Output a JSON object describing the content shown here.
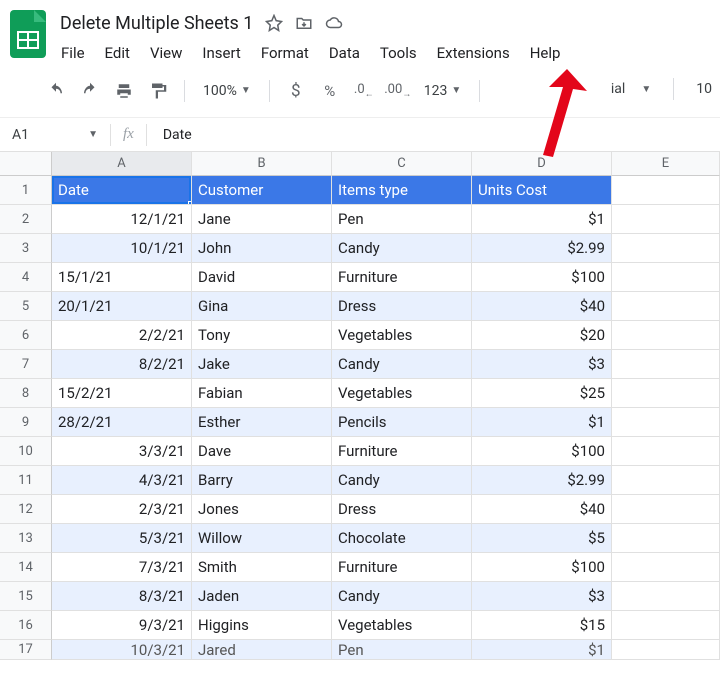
{
  "doc_title": "Delete Multiple Sheets 1",
  "menus": [
    "File",
    "Edit",
    "View",
    "Insert",
    "Format",
    "Data",
    "Tools",
    "Extensions",
    "Help"
  ],
  "toolbar": {
    "zoom": "100%",
    "num_tail": "123",
    "font_right_label": "ial",
    "font_right_num": "10"
  },
  "name_box": "A1",
  "fx_value": "Date",
  "columns": [
    "A",
    "B",
    "C",
    "D",
    "E"
  ],
  "headers": [
    "Date",
    "Customer",
    "Items type",
    "Units Cost"
  ],
  "rows": [
    [
      "12/1/21",
      "Jane",
      "Pen",
      "$1"
    ],
    [
      "10/1/21",
      "John",
      "Candy",
      "$2.99"
    ],
    [
      "15/1/21",
      "David",
      "Furniture",
      "$100"
    ],
    [
      "20/1/21",
      "Gina",
      "Dress",
      "$40"
    ],
    [
      "2/2/21",
      "Tony",
      "Vegetables",
      "$20"
    ],
    [
      "8/2/21",
      "Jake",
      "Candy",
      "$3"
    ],
    [
      "15/2/21",
      "Fabian",
      "Vegetables",
      "$25"
    ],
    [
      "28/2/21",
      "Esther",
      "Pencils",
      "$1"
    ],
    [
      "3/3/21",
      "Dave",
      "Furniture",
      "$100"
    ],
    [
      "4/3/21",
      "Barry",
      "Candy",
      "$2.99"
    ],
    [
      "2/3/21",
      "Jones",
      "Dress",
      "$40"
    ],
    [
      "5/3/21",
      "Willow",
      "Chocolate",
      "$5"
    ],
    [
      "7/3/21",
      "Smith",
      "Furniture",
      "$100"
    ],
    [
      "8/3/21",
      "Jaden",
      "Candy",
      "$3"
    ],
    [
      "9/3/21",
      "Higgins",
      "Vegetables",
      "$15"
    ],
    [
      "10/3/21",
      "Jared",
      "Pen",
      "$1"
    ]
  ],
  "date_align_right": [
    true,
    true,
    false,
    false,
    true,
    true,
    false,
    false,
    true,
    true,
    true,
    true,
    true,
    true,
    true,
    true
  ]
}
